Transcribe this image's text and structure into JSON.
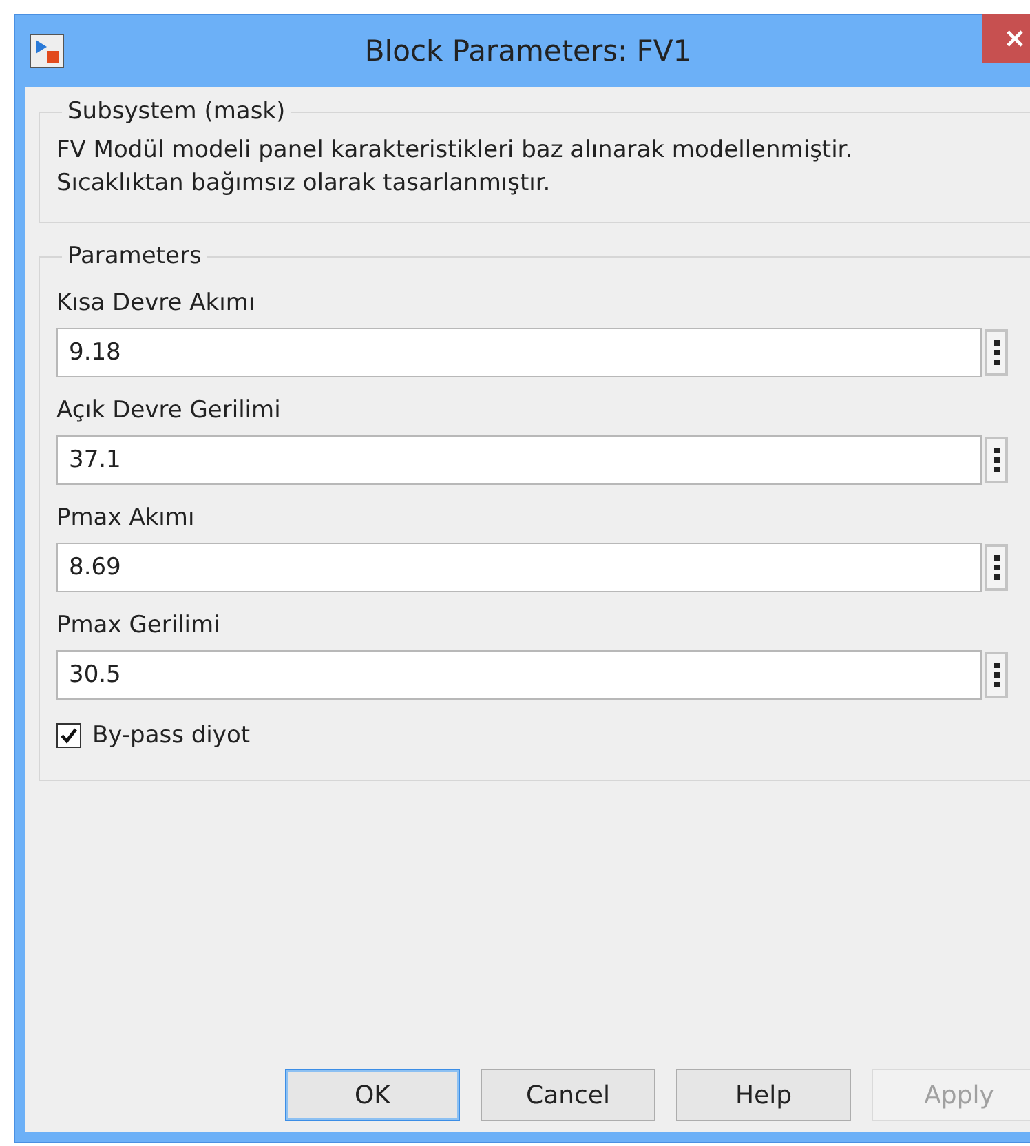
{
  "window": {
    "title": "Block Parameters: FV1"
  },
  "description_group": {
    "title": "Subsystem (mask)",
    "text": "FV Modül modeli panel karakteristikleri baz alınarak modellenmiştir.\nSıcaklıktan bağımsız olarak tasarlanmıştır."
  },
  "parameters_group": {
    "title": "Parameters",
    "fields": [
      {
        "label": "Kısa Devre Akımı",
        "value": "9.18"
      },
      {
        "label": "Açık Devre Gerilimi",
        "value": "37.1"
      },
      {
        "label": "Pmax Akımı",
        "value": "8.69"
      },
      {
        "label": "Pmax Gerilimi",
        "value": "30.5"
      }
    ],
    "checkbox": {
      "label": "By-pass diyot",
      "checked": true
    }
  },
  "buttons": [
    {
      "label": "OK",
      "default": true,
      "disabled": false
    },
    {
      "label": "Cancel",
      "default": false,
      "disabled": false
    },
    {
      "label": "Help",
      "default": false,
      "disabled": false
    },
    {
      "label": "Apply",
      "default": false,
      "disabled": true
    }
  ]
}
